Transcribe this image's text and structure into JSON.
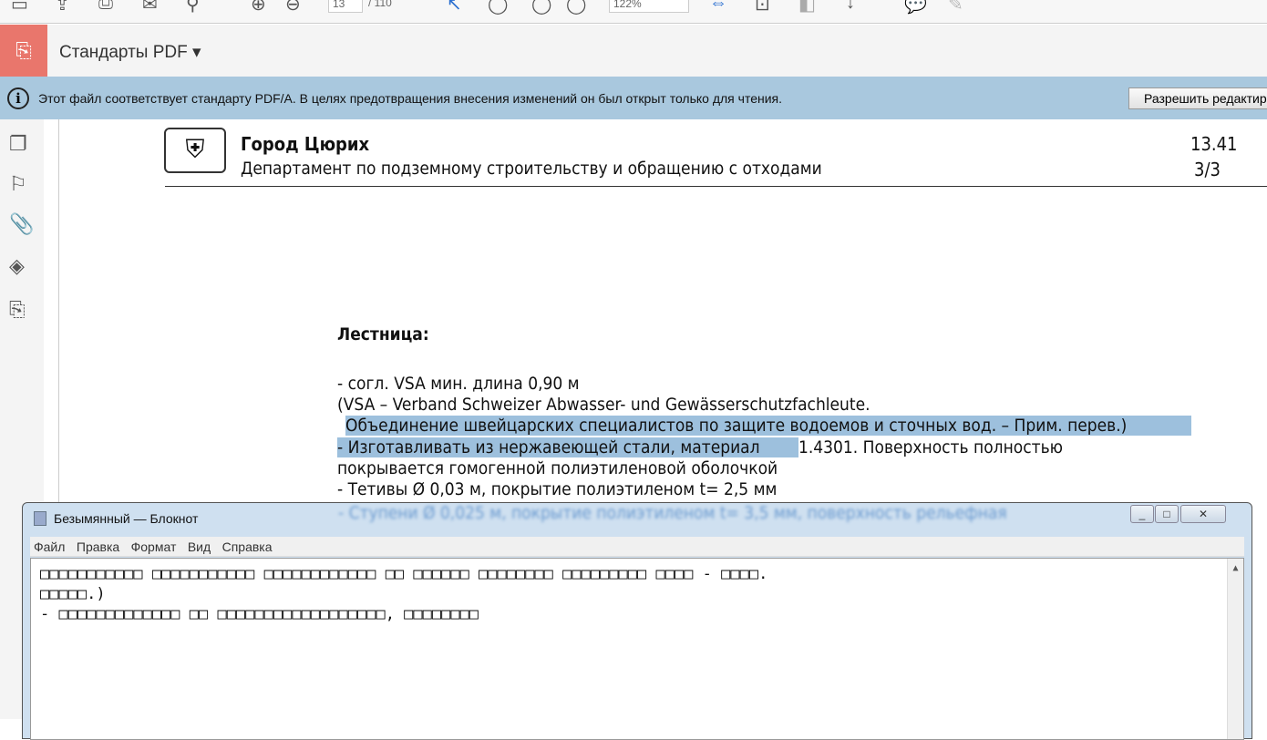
{
  "toolbar": {
    "page_current": "13",
    "page_total": "/ 110",
    "zoom": "122%"
  },
  "standards": {
    "label": "Стандарты PDF ▾"
  },
  "infobar": {
    "text": "Этот файл соответствует стандарту PDF/A. В целях предотвращения внесения изменений он был открыт только для чтения.",
    "button": "Разрешить редактирование"
  },
  "doc": {
    "header_city": "Город Цюрих",
    "header_dept": "Департамент по подземному строительству и обращению с отходами",
    "header_num": "13.41",
    "header_page": "3/3",
    "heading": "Лестница:",
    "lines": [
      "- согл. VSA мин. длина 0,90 м",
      "  (VSA – Verband Schweizer Abwasser- und Gewässerschutzfachleute.",
      "Объединение швейцарских специалистов по защите водоемов и сточных вод. – Прим. перев.)",
      "- Изготавливать из нержавеющей стали, материал",
      " 1.4301. Поверхность полностью",
      "  покрывается гомогенной полиэтиленовой оболочкой",
      "- Тетивы Ø 0,03 м, покрытие полиэтиленом t= 2,5 мм",
      "- Ступени Ø 0,025 м, покрытие полиэтиленом t= 3,5 мм, поверхность рельефная"
    ]
  },
  "notepad": {
    "title": "Безымянный — Блокнот",
    "menu": [
      "Файл",
      "Правка",
      "Формат",
      "Вид",
      "Справка"
    ],
    "content": "□□□□□□□□□□□ □□□□□□□□□□□ □□□□□□□□□□□□ □□ □□□□□□ □□□□□□□□ □□□□□□□□□ □□□□ - □□□□.\n□□□□□.)\n- □□□□□□□□□□□□□ □□ □□□□□□□□□□□□□□□□□□, □□□□□□□□"
  }
}
